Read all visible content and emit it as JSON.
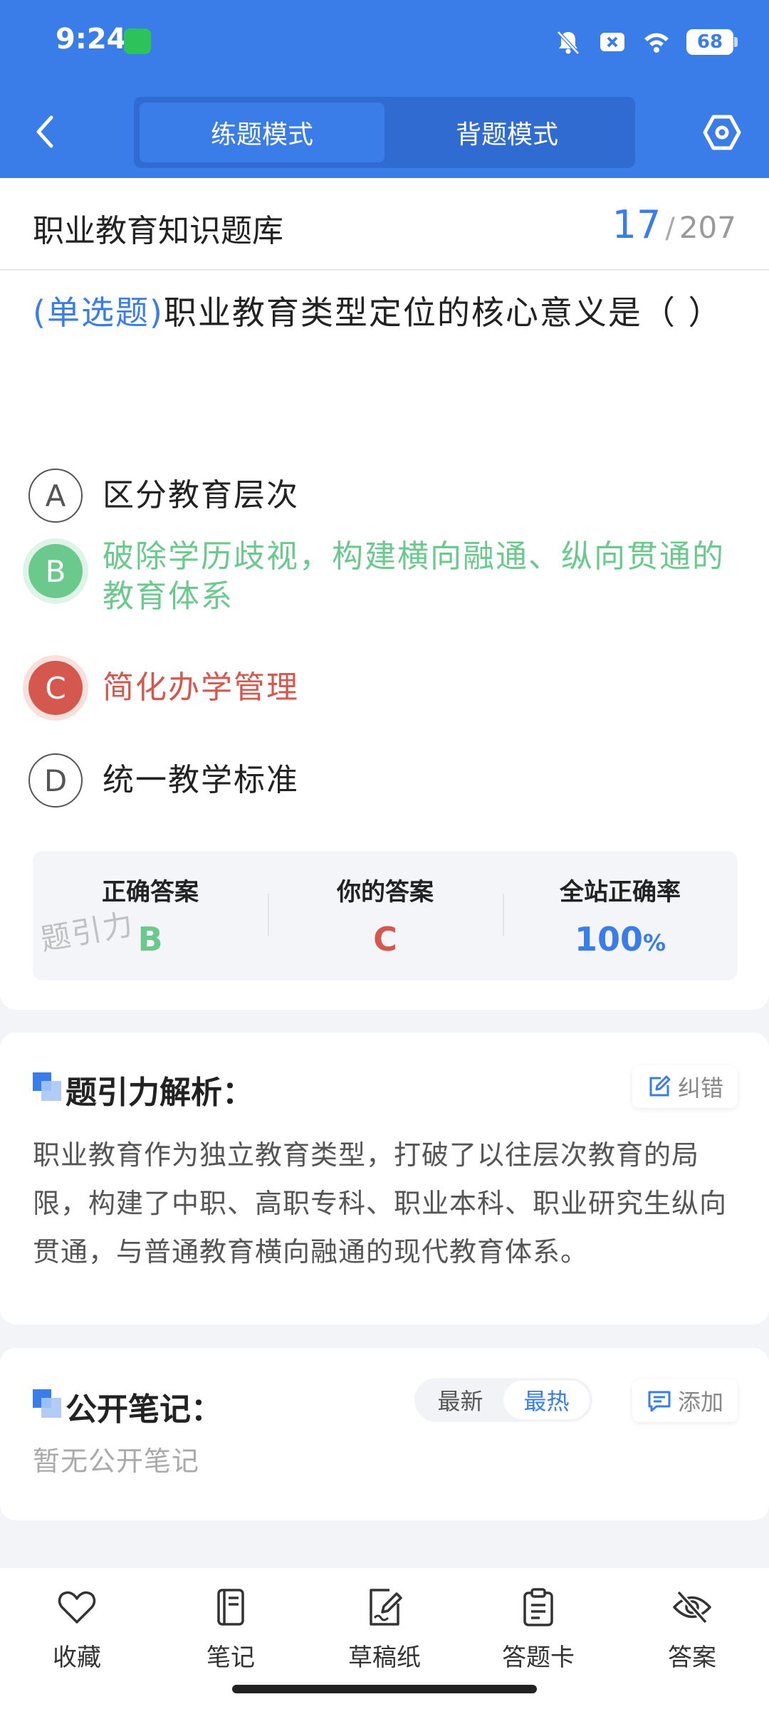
{
  "status": {
    "time": "9:24",
    "battery": "68"
  },
  "header": {
    "tabs": [
      {
        "label": "练题模式",
        "active": true
      },
      {
        "label": "背题模式",
        "active": false
      }
    ]
  },
  "bank": {
    "title": "职业教育知识题库",
    "current": "17",
    "separator": "/",
    "total": "207"
  },
  "question": {
    "type": "(单选题)",
    "text": "职业教育类型定位的核心意义是（ ）"
  },
  "options": [
    {
      "letter": "A",
      "text": "区分教育层次",
      "state": "normal"
    },
    {
      "letter": "B",
      "text": "破除学历歧视，构建横向融通、纵向贯通的教育体系",
      "state": "correct"
    },
    {
      "letter": "C",
      "text": "简化办学管理",
      "state": "wrong"
    },
    {
      "letter": "D",
      "text": "统一教学标准",
      "state": "normal"
    }
  ],
  "answers": {
    "correct_label": "正确答案",
    "correct_value": "B",
    "yours_label": "你的答案",
    "yours_value": "C",
    "rate_label": "全站正确率",
    "rate_value": "100",
    "rate_unit": "%",
    "watermark": "题引力"
  },
  "analysis": {
    "title": "题引力解析：",
    "report_label": "纠错",
    "text": "职业教育作为独立教育类型，打破了以往层次教育的局限，构建了中职、高职专科、职业本科、职业研究生纵向贯通，与普通教育横向融通的现代教育体系。"
  },
  "notes": {
    "title": "公开笔记：",
    "sort_newest": "最新",
    "sort_hottest": "最热",
    "add_label": "添加",
    "empty": "暂无公开笔记"
  },
  "bottom_nav": [
    {
      "label": "收藏",
      "icon": "heart-icon"
    },
    {
      "label": "笔记",
      "icon": "notebook-icon"
    },
    {
      "label": "草稿纸",
      "icon": "draft-icon"
    },
    {
      "label": "答题卡",
      "icon": "clipboard-icon"
    },
    {
      "label": "答案",
      "icon": "eye-off-icon"
    }
  ],
  "colors": {
    "primary": "#3a7de8",
    "correct": "#6cc98e",
    "wrong": "#d4584d"
  }
}
